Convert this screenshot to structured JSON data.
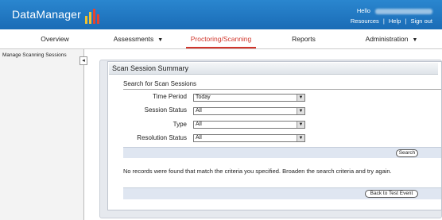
{
  "app": {
    "logo_text": "DataManager",
    "hello_label": "Hello",
    "links": [
      "Resources",
      "Help",
      "Sign out"
    ],
    "separator": "|"
  },
  "nav": {
    "items": [
      {
        "label": "Overview",
        "dropdown": false,
        "active": false
      },
      {
        "label": "Assessments",
        "dropdown": true,
        "active": false
      },
      {
        "label": "Proctoring/Scanning",
        "dropdown": true,
        "active": true
      },
      {
        "label": "Reports",
        "dropdown": false,
        "active": false
      },
      {
        "label": "Administration",
        "dropdown": true,
        "active": false
      }
    ]
  },
  "sidebar": {
    "title": "Manage Scanning Sessions",
    "collapse_glyph": "◂"
  },
  "panel": {
    "title": "Scan Session Summary",
    "search_heading": "Search for Scan Sessions",
    "fields": [
      {
        "label": "Time Period",
        "value": "Today"
      },
      {
        "label": "Session Status",
        "value": "All"
      },
      {
        "label": "Type",
        "value": "All"
      },
      {
        "label": "Resolution Status",
        "value": "All"
      }
    ],
    "search_button": "Search",
    "message": "No records were found that match the criteria you specified. Broaden the search criteria and try again.",
    "back_button": "Back to Test Event"
  },
  "colors": {
    "header_blue": "#1f78c1",
    "active_red": "#d0352b",
    "logo_bars": [
      "#f2c230",
      "#f2c230",
      "#e8432e",
      "#e8432e"
    ]
  }
}
